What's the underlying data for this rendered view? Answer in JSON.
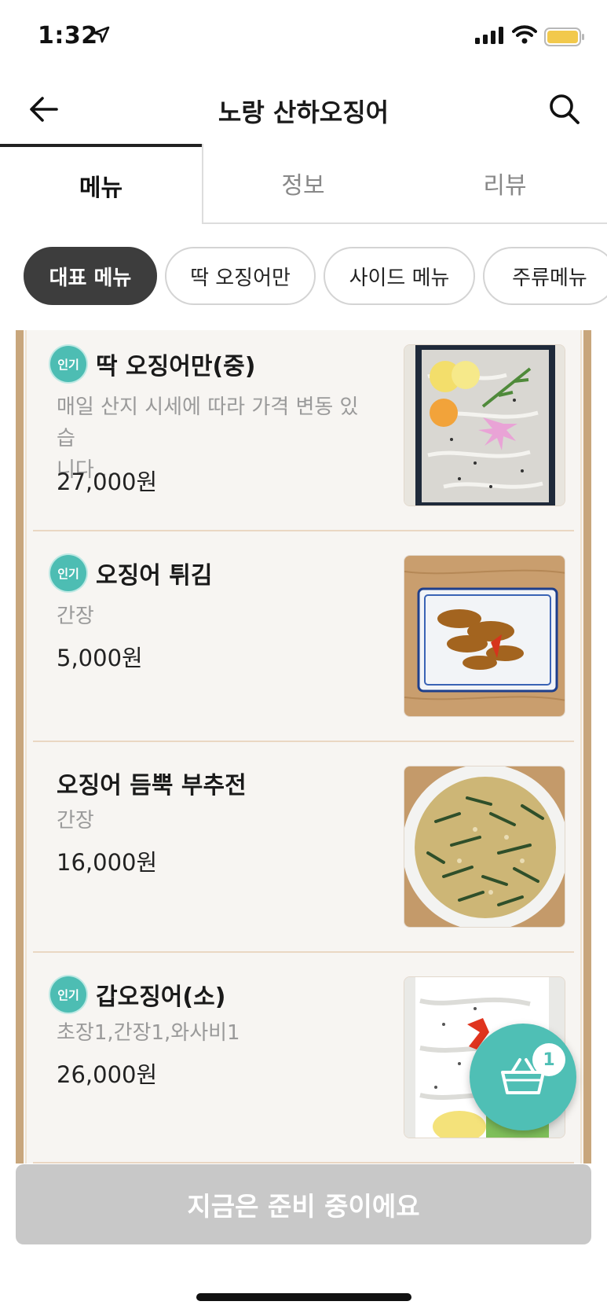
{
  "status": {
    "time": "1:32"
  },
  "header": {
    "title": "노랑 산하오징어"
  },
  "tabs": [
    {
      "label": "메뉴"
    },
    {
      "label": "정보"
    },
    {
      "label": "리뷰"
    }
  ],
  "categories": [
    {
      "label": "대표 메뉴"
    },
    {
      "label": "딱 오징어만"
    },
    {
      "label": "사이드 메뉴"
    },
    {
      "label": "주류메뉴"
    }
  ],
  "menu": {
    "badge_label": "인기",
    "items": [
      {
        "name": "딱 오징어만(중)",
        "desc_line1": "매일 산지 시세에 따라 가격 변동 있습",
        "desc_line2": "니다.…",
        "price": "27,000원"
      },
      {
        "name": "오징어 튀김",
        "desc": "간장",
        "price": "5,000원"
      },
      {
        "name": "오징어 듬뿍 부추전",
        "desc": "간장",
        "price": "16,000원"
      },
      {
        "name": "갑오징어(소)",
        "desc": "초장1,간장1,와사비1",
        "price": "26,000원"
      }
    ]
  },
  "cart": {
    "count": "1"
  },
  "order_bar": {
    "label": "지금은 준비 중이에요"
  },
  "colors": {
    "accent": "#4fbfb5",
    "frame": "#c8a67c",
    "disabled": "#c8c8c8"
  }
}
